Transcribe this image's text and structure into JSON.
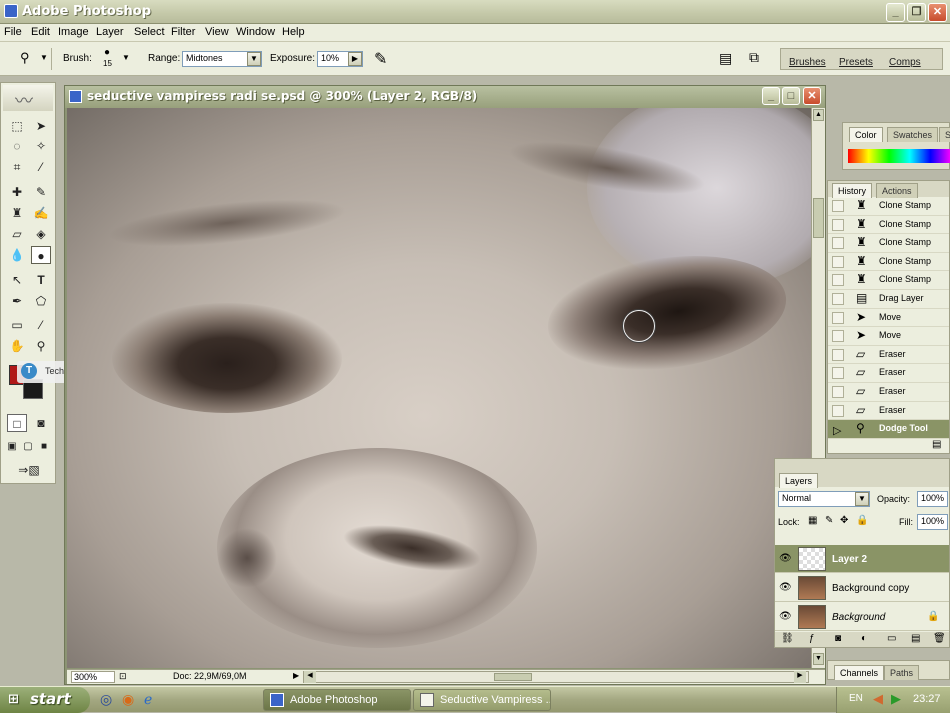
{
  "app": {
    "title": "Adobe Photoshop"
  },
  "menu": [
    "File",
    "Edit",
    "Image",
    "Layer",
    "Select",
    "Filter",
    "View",
    "Window",
    "Help"
  ],
  "options": {
    "brush_label": "Brush:",
    "brush_size": "15",
    "range_label": "Range:",
    "range_value": "Midtones",
    "exposure_label": "Exposure:",
    "exposure_value": "10%"
  },
  "palette_well": [
    "Brushes",
    "Presets",
    "Comps"
  ],
  "document": {
    "title": "seductive vampiress radi se.psd @ 300% (Layer 2, RGB/8)",
    "zoom": "300%",
    "doc_info": "Doc: 22,9M/69,0M"
  },
  "watermark": "TechTut.com",
  "color_palette": {
    "tabs": [
      "Color",
      "Swatches",
      "S"
    ]
  },
  "history": {
    "tabs": [
      "History",
      "Actions"
    ],
    "items": [
      "Clone Stamp",
      "Clone Stamp",
      "Clone Stamp",
      "Clone Stamp",
      "Clone Stamp",
      "Drag Layer",
      "Move",
      "Move",
      "Eraser",
      "Eraser",
      "Eraser",
      "Eraser",
      "Dodge Tool"
    ],
    "selected_index": 12
  },
  "layers": {
    "tab": "Layers",
    "blend_mode": "Normal",
    "opacity_label": "Opacity:",
    "opacity": "100%",
    "lock_label": "Lock:",
    "fill_label": "Fill:",
    "fill": "100%",
    "items": [
      "Layer 2",
      "Background copy",
      "Background"
    ],
    "selected_index": 0
  },
  "channels": {
    "tabs": [
      "Channels",
      "Paths"
    ]
  },
  "taskbar": {
    "start": "start",
    "tasks": [
      "Adobe Photoshop",
      "Seductive Vampiress ..."
    ],
    "lang": "EN",
    "clock": "23:27"
  },
  "colors": {
    "foreground": "#b01818",
    "background": "#1a1a1a",
    "selection": "#8a9466"
  }
}
